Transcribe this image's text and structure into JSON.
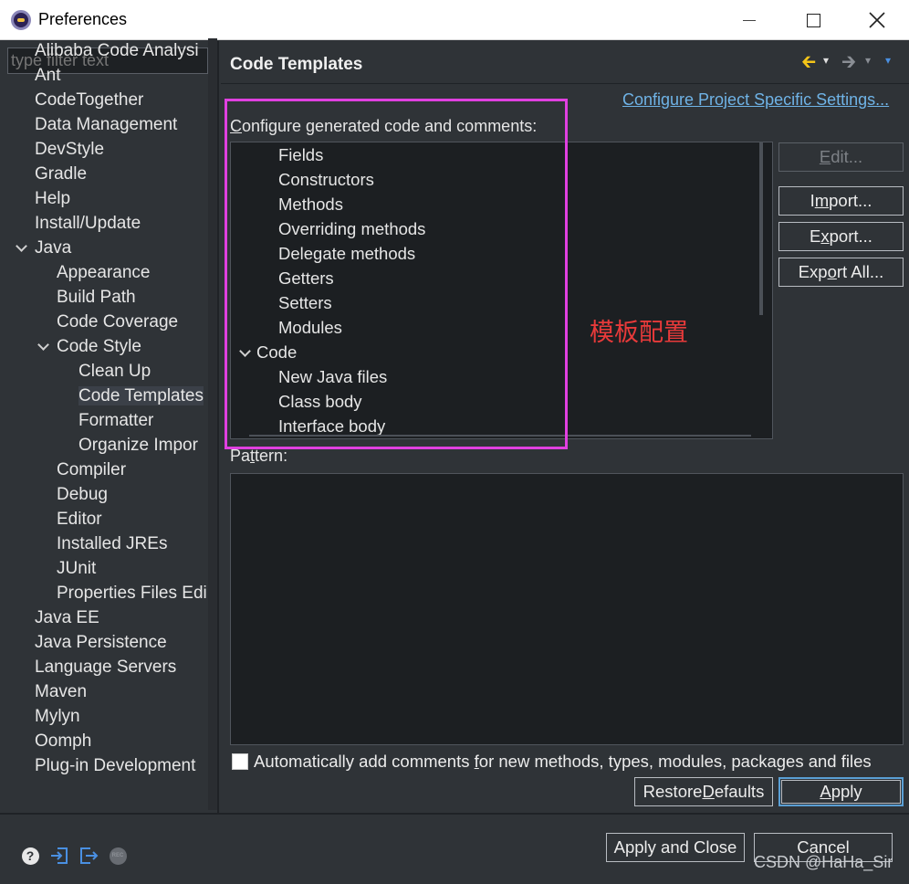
{
  "window": {
    "title": "Preferences"
  },
  "sidebar": {
    "filter_placeholder": "type filter text",
    "items": [
      {
        "label": "Alibaba Code Analysi",
        "indent": 0,
        "chevron": "none"
      },
      {
        "label": "Ant",
        "indent": 0,
        "chevron": "right"
      },
      {
        "label": "CodeTogether",
        "indent": 0,
        "chevron": "none"
      },
      {
        "label": "Data Management",
        "indent": 0,
        "chevron": "right"
      },
      {
        "label": "DevStyle",
        "indent": 0,
        "chevron": "right"
      },
      {
        "label": "Gradle",
        "indent": 0,
        "chevron": "right"
      },
      {
        "label": "Help",
        "indent": 0,
        "chevron": "right"
      },
      {
        "label": "Install/Update",
        "indent": 0,
        "chevron": "right"
      },
      {
        "label": "Java",
        "indent": 0,
        "chevron": "down"
      },
      {
        "label": "Appearance",
        "indent": 1,
        "chevron": "right"
      },
      {
        "label": "Build Path",
        "indent": 1,
        "chevron": "right"
      },
      {
        "label": "Code Coverage",
        "indent": 1,
        "chevron": "none"
      },
      {
        "label": "Code Style",
        "indent": 1,
        "chevron": "down"
      },
      {
        "label": "Clean Up",
        "indent": 2,
        "chevron": "none"
      },
      {
        "label": "Code Templates",
        "indent": 2,
        "chevron": "none",
        "selected": true
      },
      {
        "label": "Formatter",
        "indent": 2,
        "chevron": "none"
      },
      {
        "label": "Organize Impor",
        "indent": 2,
        "chevron": "none"
      },
      {
        "label": "Compiler",
        "indent": 1,
        "chevron": "right"
      },
      {
        "label": "Debug",
        "indent": 1,
        "chevron": "right"
      },
      {
        "label": "Editor",
        "indent": 1,
        "chevron": "right"
      },
      {
        "label": "Installed JREs",
        "indent": 1,
        "chevron": "right"
      },
      {
        "label": "JUnit",
        "indent": 1,
        "chevron": "none"
      },
      {
        "label": "Properties Files Edi",
        "indent": 1,
        "chevron": "none"
      },
      {
        "label": "Java EE",
        "indent": 0,
        "chevron": "right"
      },
      {
        "label": "Java Persistence",
        "indent": 0,
        "chevron": "right"
      },
      {
        "label": "Language Servers",
        "indent": 0,
        "chevron": "right"
      },
      {
        "label": "Maven",
        "indent": 0,
        "chevron": "right"
      },
      {
        "label": "Mylyn",
        "indent": 0,
        "chevron": "right"
      },
      {
        "label": "Oomph",
        "indent": 0,
        "chevron": "right"
      },
      {
        "label": "Plug-in Development",
        "indent": 0,
        "chevron": "right"
      }
    ]
  },
  "page": {
    "title": "Code Templates",
    "project_link": "Configure Project Specific Settings...",
    "configure_label_first": "C",
    "configure_label_rest": "onfigure generated code and comments:",
    "templates": [
      {
        "label": "Fields",
        "level": 1
      },
      {
        "label": "Constructors",
        "level": 1
      },
      {
        "label": "Methods",
        "level": 1
      },
      {
        "label": "Overriding methods",
        "level": 1
      },
      {
        "label": "Delegate methods",
        "level": 1
      },
      {
        "label": "Getters",
        "level": 1
      },
      {
        "label": "Setters",
        "level": 1
      },
      {
        "label": "Modules",
        "level": 1
      },
      {
        "label": "Code",
        "level": 0,
        "expanded": true
      },
      {
        "label": "New Java files",
        "level": 1
      },
      {
        "label": "Class body",
        "level": 1
      },
      {
        "label": "Interface body",
        "level": 1
      }
    ],
    "annotation": "模板配置",
    "pattern_label_a": "Pa",
    "pattern_label_u": "t",
    "pattern_label_b": "tern:",
    "checkbox_a": "Automatically add comments ",
    "checkbox_u": "f",
    "checkbox_b": "or new methods, types, modules, packages and files"
  },
  "buttons": {
    "edit": {
      "a": "",
      "u": "E",
      "b": "dit..."
    },
    "import": {
      "a": "I",
      "u": "m",
      "b": "port..."
    },
    "export": {
      "a": "E",
      "u": "x",
      "b": "port..."
    },
    "export_all": {
      "a": "Exp",
      "u": "o",
      "b": "rt All..."
    },
    "restore": {
      "a": "Restore ",
      "u": "D",
      "b": "efaults"
    },
    "apply": {
      "a": "",
      "u": "A",
      "b": "pply"
    },
    "apply_close": "Apply and Close",
    "cancel": "Cancel"
  },
  "colors": {
    "background": "#2f3337",
    "tree_bg": "#1c1f22",
    "link": "#6fb3e6",
    "highlight_box": "#e040e0",
    "annotation": "#e83a3a"
  },
  "icons": [
    "help-icon",
    "import-prefs-icon",
    "export-prefs-icon",
    "record-icon"
  ],
  "watermark": "CSDN @HaHa_Sir"
}
